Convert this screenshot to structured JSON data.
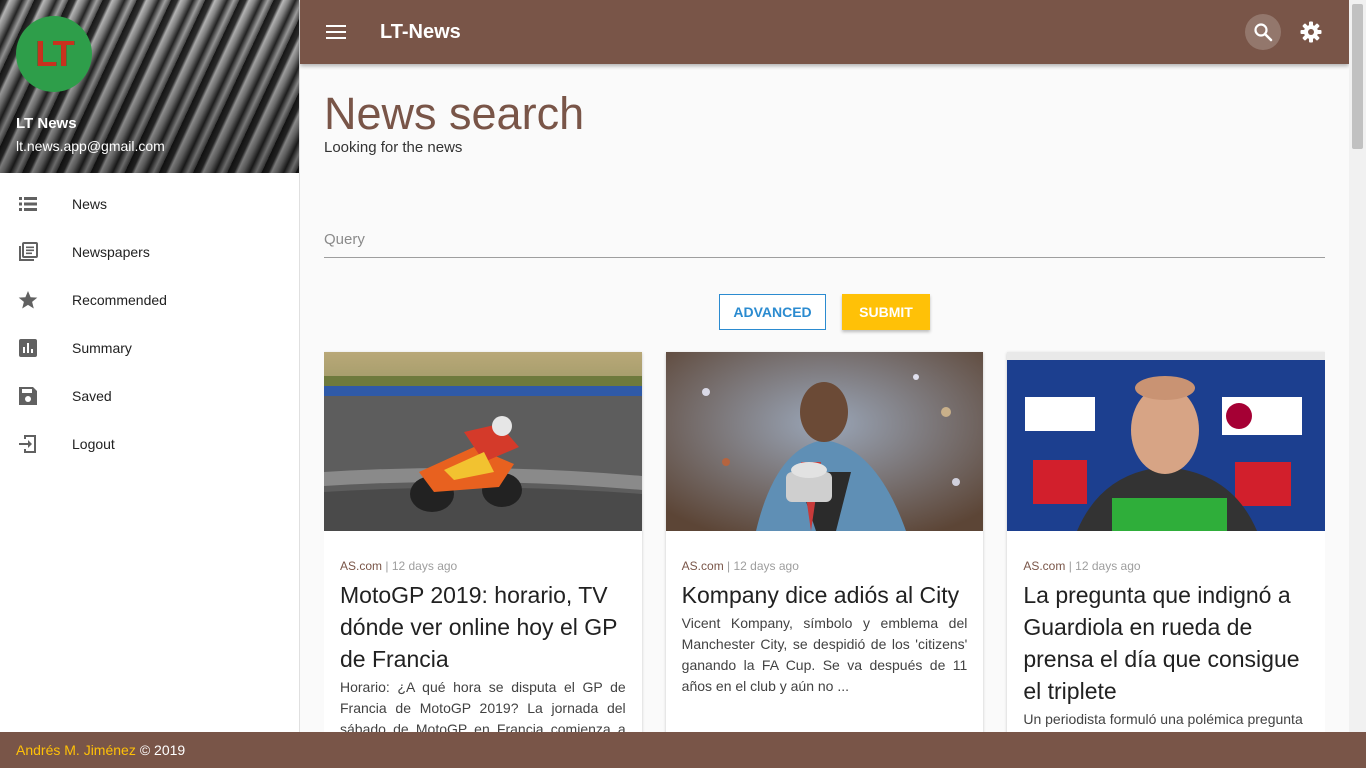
{
  "app": {
    "title": "LT-News"
  },
  "user": {
    "name": "LT News",
    "email": "lt.news.app@gmail.com",
    "logo_text": "LT"
  },
  "sidebar": {
    "items": [
      {
        "label": "News",
        "icon": "list-icon"
      },
      {
        "label": "Newspapers",
        "icon": "newspaper-icon"
      },
      {
        "label": "Recommended",
        "icon": "star-icon"
      },
      {
        "label": "Summary",
        "icon": "bar-chart-icon"
      },
      {
        "label": "Saved",
        "icon": "save-icon"
      },
      {
        "label": "Logout",
        "icon": "logout-icon"
      }
    ]
  },
  "page": {
    "title": "News search",
    "subtitle": "Looking for the news"
  },
  "search": {
    "placeholder": "Query",
    "value": ""
  },
  "buttons": {
    "advanced": "ADVANCED",
    "submit": "SUBMIT"
  },
  "cards": [
    {
      "source": "AS.com",
      "separator": "|",
      "time": "12 days ago",
      "title": "MotoGP 2019: horario, TV dónde ver online hoy el GP de Francia",
      "description": "Horario: ¿A qué hora se disputa el GP de Francia de MotoGP 2019? La jornada del sábado de MotoGP en Francia comienza a las"
    },
    {
      "source": "AS.com",
      "separator": "|",
      "time": "12 days ago",
      "title": "Kompany dice adiós al City",
      "description": "Vicent Kompany, símbolo y emblema del Manchester City, se despidió de los 'citizens' ganando la FA Cup. Se va después de 11 años en el club y aún no ..."
    },
    {
      "source": "AS.com",
      "separator": "|",
      "time": "12 days ago",
      "title": "La pregunta que indignó a Guardiola en rueda de prensa el día que consigue el triplete",
      "description": "Un periodista formuló una polémica pregunta"
    }
  ],
  "footer": {
    "author": "Andrés M. Jiménez",
    "copyright": "© 2019"
  },
  "colors": {
    "primary": "#795548",
    "accent": "#ffc107",
    "link": "#2b8bd0"
  }
}
